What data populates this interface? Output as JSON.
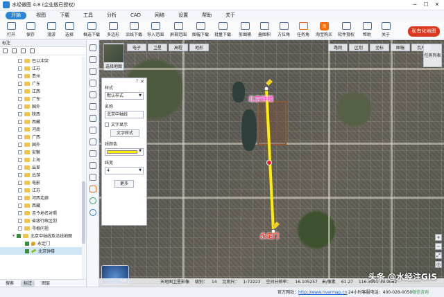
{
  "app": {
    "title": "水经微图 4.8 (企业版已授权)",
    "window_buttons": [
      "─",
      "☐",
      "✕"
    ]
  },
  "menu": [
    "开始",
    "视图",
    "下载",
    "工具",
    "分析",
    "CAD",
    "网络",
    "设置",
    "帮助",
    "关于"
  ],
  "toolbar": {
    "items": [
      "打开",
      "保存",
      "漫游",
      "选择",
      "框选下载",
      "多边形",
      "沿线下载",
      "导入范围",
      "屏幕范围",
      "图幅下载",
      "批量下载",
      "剪图桶",
      "叠图积",
      "方位角",
      "任务角",
      "淘宝购买",
      "软件授权",
      "帮助",
      "关于"
    ],
    "taobao_badge": "淘",
    "private_btn": "私有化地图"
  },
  "left_panel": {
    "header": "标注",
    "tree": [
      {
        "label": "巴以冲突",
        "type": "folder",
        "checked": false
      },
      {
        "label": "江苏",
        "type": "folder",
        "checked": false
      },
      {
        "label": "贵州",
        "type": "folder",
        "checked": false
      },
      {
        "label": "广东",
        "type": "folder",
        "checked": false
      },
      {
        "label": "江西",
        "type": "folder",
        "checked": false
      },
      {
        "label": "广东",
        "type": "folder",
        "checked": false
      },
      {
        "label": "国外",
        "type": "folder",
        "checked": false
      },
      {
        "label": "陕西",
        "type": "folder",
        "checked": false
      },
      {
        "label": "西藏",
        "type": "folder",
        "checked": false
      },
      {
        "label": "河南",
        "type": "folder",
        "checked": false
      },
      {
        "label": "广西",
        "type": "folder",
        "checked": false
      },
      {
        "label": "国外",
        "type": "folder",
        "checked": false
      },
      {
        "label": "安徽",
        "type": "folder",
        "checked": false
      },
      {
        "label": "上海",
        "type": "folder",
        "checked": false
      },
      {
        "label": "出差",
        "type": "folder",
        "checked": false
      },
      {
        "label": "出游",
        "type": "folder",
        "checked": false
      },
      {
        "label": "电影",
        "type": "folder",
        "checked": false
      },
      {
        "label": "江苏",
        "type": "folder",
        "checked": false
      },
      {
        "label": "河西走廊",
        "type": "folder",
        "checked": false
      },
      {
        "label": "西藏",
        "type": "folder",
        "checked": false
      },
      {
        "label": "吉今地名对照",
        "type": "folder",
        "checked": false
      },
      {
        "label": "省级行政区划",
        "type": "folder",
        "checked": false
      },
      {
        "label": "寻根问祖",
        "type": "folder",
        "checked": false
      },
      {
        "label": "北京中轴线及沿线地图",
        "type": "folder",
        "checked": true,
        "expanded": true
      },
      {
        "label": "永定门",
        "type": "pin",
        "checked": true
      },
      {
        "label": "北京钟楼",
        "type": "line",
        "checked": true,
        "selected": true
      }
    ],
    "tabs": [
      "搜索",
      "标注",
      "图层"
    ],
    "active_tab": "标注"
  },
  "map": {
    "base_tabs": [
      "电子",
      "卫星",
      "高程",
      "地形"
    ],
    "overlay_tabs": [
      "路网",
      "区划",
      "坐标",
      "图幅",
      "瓦片"
    ],
    "task_btn": "任务列表",
    "switch_label": "选择地图",
    "compass_label": "地球",
    "labels": {
      "bell_tower": "北京钟楼",
      "gate": "永定门"
    },
    "route_color": "#ffee00",
    "watermark": "头条 @水经注GIS",
    "status": {
      "source": "天地图卫星影像",
      "zoom_label": "级别：",
      "zoom_value": "14",
      "scale_label": "比例尺：",
      "scale_value": "1:72223",
      "resolution_label": "空间分辨率：",
      "resolution_value": "16.105257",
      "unit_label": "米/像素",
      "altitude": "61.27",
      "coord": "116.3991 39.9082"
    }
  },
  "style_panel": {
    "help": "?",
    "close": "✕",
    "style_label": "样式",
    "style_value": "默认样式",
    "name_label": "名称",
    "name_value": "北京中轴线",
    "text_show": "文字显示",
    "text_style_btn": "文字样式",
    "line_color_label": "线颜色",
    "line_color": "#ffee00",
    "line_width_label": "线宽",
    "line_width_value": "4",
    "more_btn": "更多"
  },
  "status_bar": {
    "official_label": "官方网站：",
    "url": "http://www.rivermap.cn",
    "phone": "24小时客服电话：400-028-0050",
    "wechat": "微信咨询"
  }
}
